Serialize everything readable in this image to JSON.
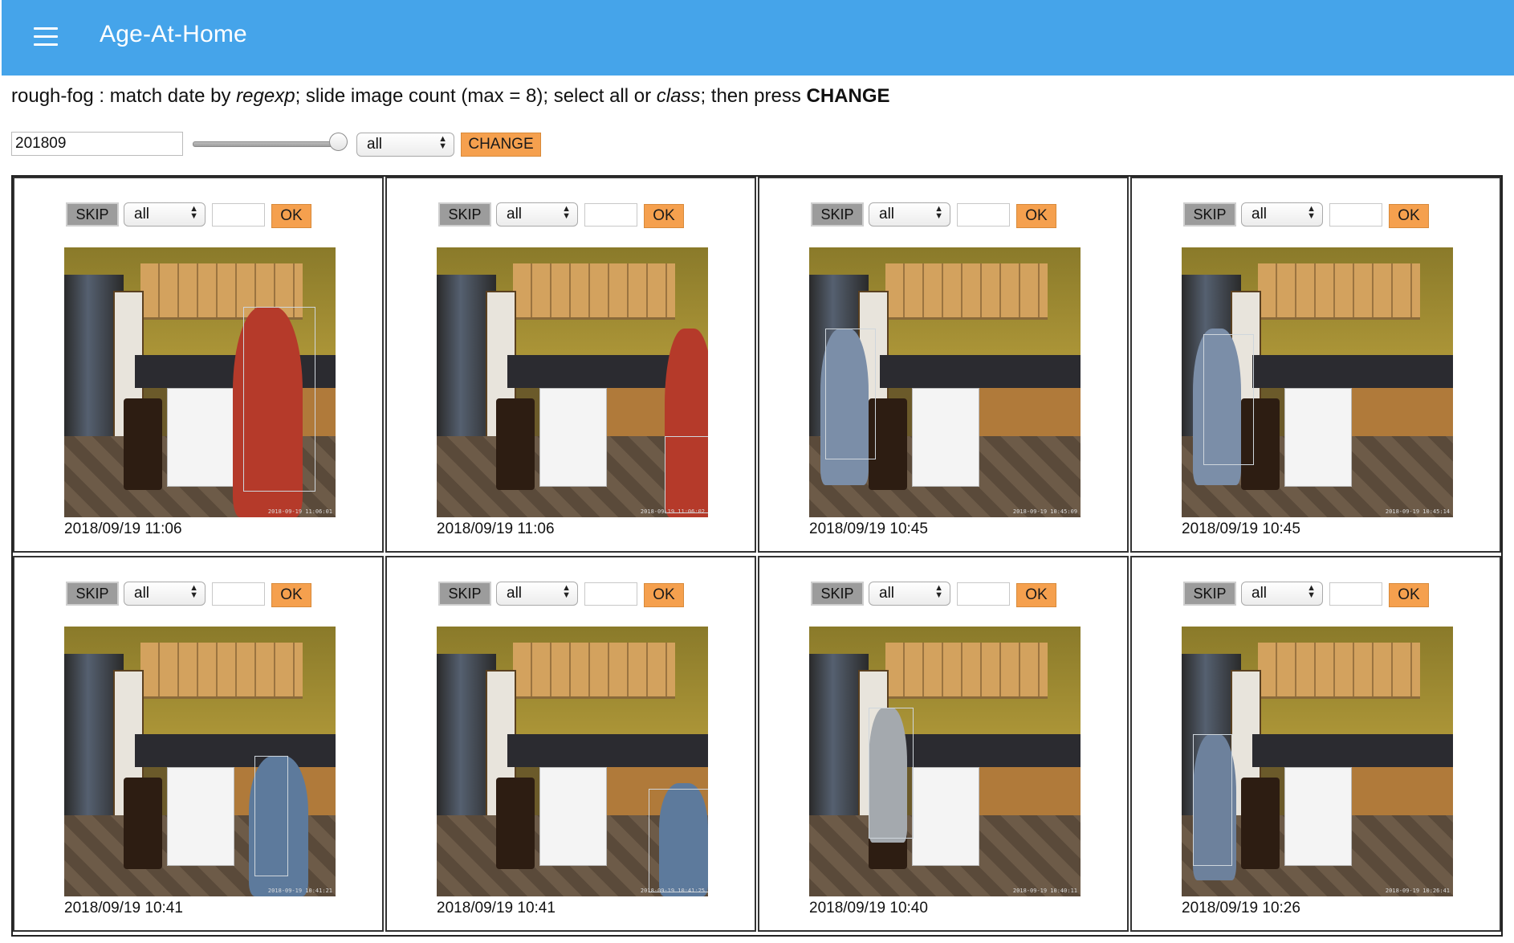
{
  "app": {
    "title": "Age-At-Home",
    "menu_icon": "hamburger-menu-icon"
  },
  "instructions": {
    "part1": "rough-fog : match date by ",
    "regexp": "regexp",
    "part2": "; slide image count (max = 8); select all or ",
    "class": "class",
    "part3": "; then press ",
    "change": "CHANGE"
  },
  "controls": {
    "date_value": "201809",
    "slider_value": 8,
    "slider_max": 8,
    "class_select": "all",
    "change_label": "CHANGE"
  },
  "colors": {
    "appbar": "#45a4ea",
    "button_orange": "#f5a04e",
    "button_gray": "#9c9c9c"
  },
  "cells": [
    {
      "skip_label": "SKIP",
      "select_value": "all",
      "ok_label": "OK",
      "caption": "2018/09/19 11:06",
      "person": "red-shirt",
      "stamp": "2018-09-19 11:06:01"
    },
    {
      "skip_label": "SKIP",
      "select_value": "all",
      "ok_label": "OK",
      "caption": "2018/09/19 11:06",
      "person": "red-shirt-edge",
      "stamp": "2018-09-19 11:06:02"
    },
    {
      "skip_label": "SKIP",
      "select_value": "all",
      "ok_label": "OK",
      "caption": "2018/09/19 10:45",
      "person": "blue-left",
      "stamp": "2018-09-19 10:45:09"
    },
    {
      "skip_label": "SKIP",
      "select_value": "all",
      "ok_label": "OK",
      "caption": "2018/09/19 10:45",
      "person": "blue-left-2",
      "stamp": "2018-09-19 10:45:14"
    },
    {
      "skip_label": "SKIP",
      "select_value": "all",
      "ok_label": "OK",
      "caption": "2018/09/19 10:41",
      "person": "blue-right",
      "stamp": "2018-09-19 10:41:21"
    },
    {
      "skip_label": "SKIP",
      "select_value": "all",
      "ok_label": "OK",
      "caption": "2018/09/19 10:41",
      "person": "blue-right-edge",
      "stamp": "2018-09-19 10:41:25"
    },
    {
      "skip_label": "SKIP",
      "select_value": "all",
      "ok_label": "OK",
      "caption": "2018/09/19 10:40",
      "person": "gray-center",
      "stamp": "2018-09-19 10:40:11"
    },
    {
      "skip_label": "SKIP",
      "select_value": "all",
      "ok_label": "OK",
      "caption": "2018/09/19 10:26",
      "person": "blue-left-3",
      "stamp": "2018-09-19 10:26:41"
    }
  ]
}
